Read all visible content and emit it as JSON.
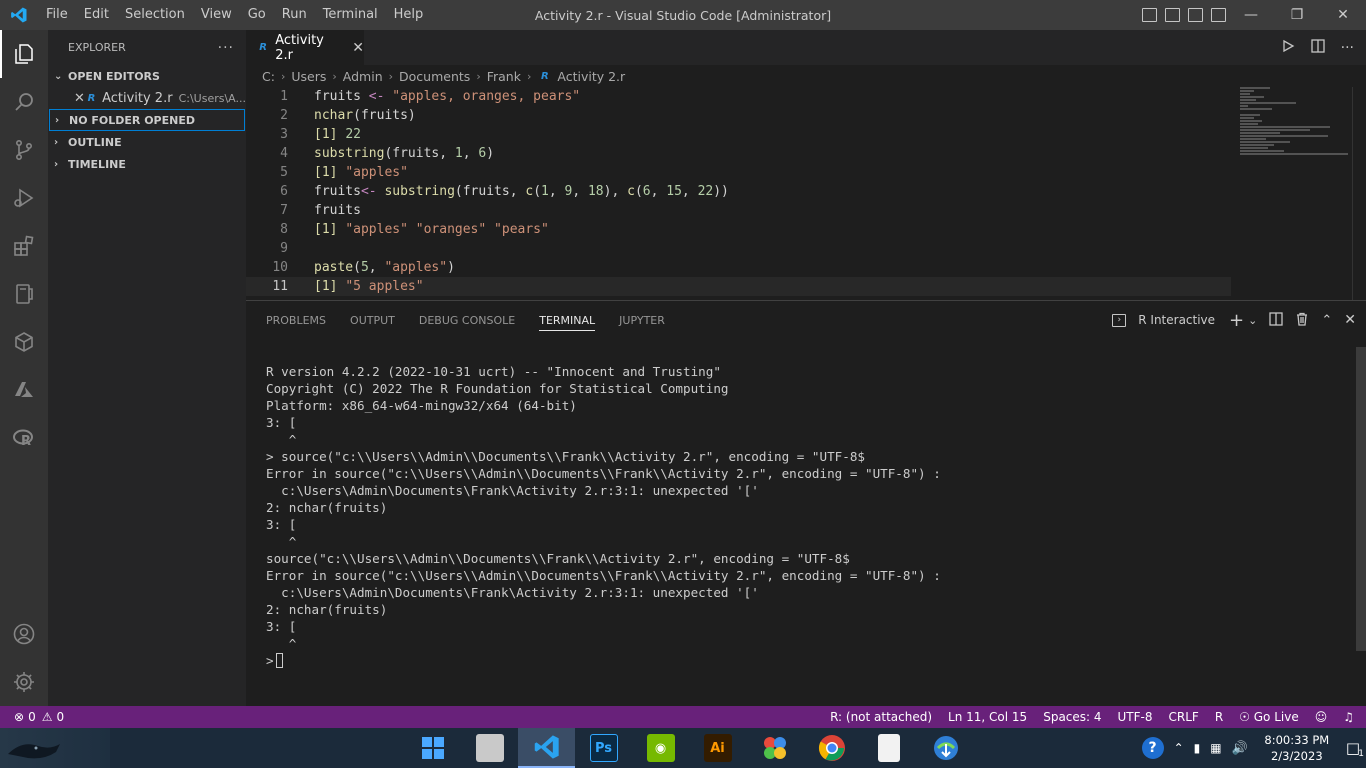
{
  "titlebar": {
    "menu": [
      "File",
      "Edit",
      "Selection",
      "View",
      "Go",
      "Run",
      "Terminal",
      "Help"
    ],
    "title": "Activity 2.r - Visual Studio Code [Administrator]"
  },
  "sidebar": {
    "header": "EXPLORER",
    "sections": {
      "open_editors": "OPEN EDITORS",
      "no_folder": "NO FOLDER OPENED",
      "outline": "OUTLINE",
      "timeline": "TIMELINE"
    },
    "open_file": {
      "name": "Activity 2.r",
      "path": "C:\\Users\\A..."
    }
  },
  "editor": {
    "tab": "Activity 2.r",
    "breadcrumb": [
      "C:",
      "Users",
      "Admin",
      "Documents",
      "Frank",
      "Activity 2.r"
    ],
    "current_line": 11,
    "lines": [
      {
        "n": "1"
      },
      {
        "n": "2"
      },
      {
        "n": "3"
      },
      {
        "n": "4"
      },
      {
        "n": "5"
      },
      {
        "n": "6"
      },
      {
        "n": "7"
      },
      {
        "n": "8"
      },
      {
        "n": "9"
      },
      {
        "n": "10"
      },
      {
        "n": "11"
      }
    ]
  },
  "panel": {
    "tabs": [
      "PROBLEMS",
      "OUTPUT",
      "DEBUG CONSOLE",
      "TERMINAL",
      "JUPYTER"
    ],
    "active_tab": "TERMINAL",
    "terminal_name": "R Interactive",
    "terminal_lines": [
      "R version 4.2.2 (2022-10-31 ucrt) -- \"Innocent and Trusting\"",
      "Copyright (C) 2022 The R Foundation for Statistical Computing",
      "Platform: x86_64-w64-mingw32/x64 (64-bit)",
      "3: [",
      "   ^",
      "> source(\"c:\\\\Users\\\\Admin\\\\Documents\\\\Frank\\\\Activity 2.r\", encoding = \"UTF-8$",
      "Error in source(\"c:\\\\Users\\\\Admin\\\\Documents\\\\Frank\\\\Activity 2.r\", encoding = \"UTF-8\") :",
      "  c:\\Users\\Admin\\Documents\\Frank\\Activity 2.r:3:1: unexpected '['",
      "2: nchar(fruits)",
      "3: [",
      "   ^",
      "source(\"c:\\\\Users\\\\Admin\\\\Documents\\\\Frank\\\\Activity 2.r\", encoding = \"UTF-8$",
      "Error in source(\"c:\\\\Users\\\\Admin\\\\Documents\\\\Frank\\\\Activity 2.r\", encoding = \"UTF-8\") :",
      "  c:\\Users\\Admin\\Documents\\Frank\\Activity 2.r:3:1: unexpected '['",
      "2: nchar(fruits)",
      "3: [",
      "   ^"
    ],
    "prompt": ">"
  },
  "statusbar": {
    "errors": "0",
    "warnings": "0",
    "r_status": "R: (not attached)",
    "position": "Ln 11, Col 15",
    "spaces": "Spaces: 4",
    "encoding": "UTF-8",
    "eol": "CRLF",
    "language": "R",
    "go_live": "Go Live"
  },
  "taskbar": {
    "apps": [
      "windows-start",
      "file-explorer",
      "vscode",
      "photoshop",
      "nvidia",
      "illustrator",
      "app-grid",
      "chrome",
      "notepad",
      "internet-download"
    ],
    "time": "8:00:33 PM",
    "date": "2/3/2023",
    "notification_count": "1"
  },
  "colors": {
    "statusbar": "#68217a",
    "activity_bar": "#333333",
    "sidebar": "#252526",
    "editor": "#1e1e1e"
  }
}
